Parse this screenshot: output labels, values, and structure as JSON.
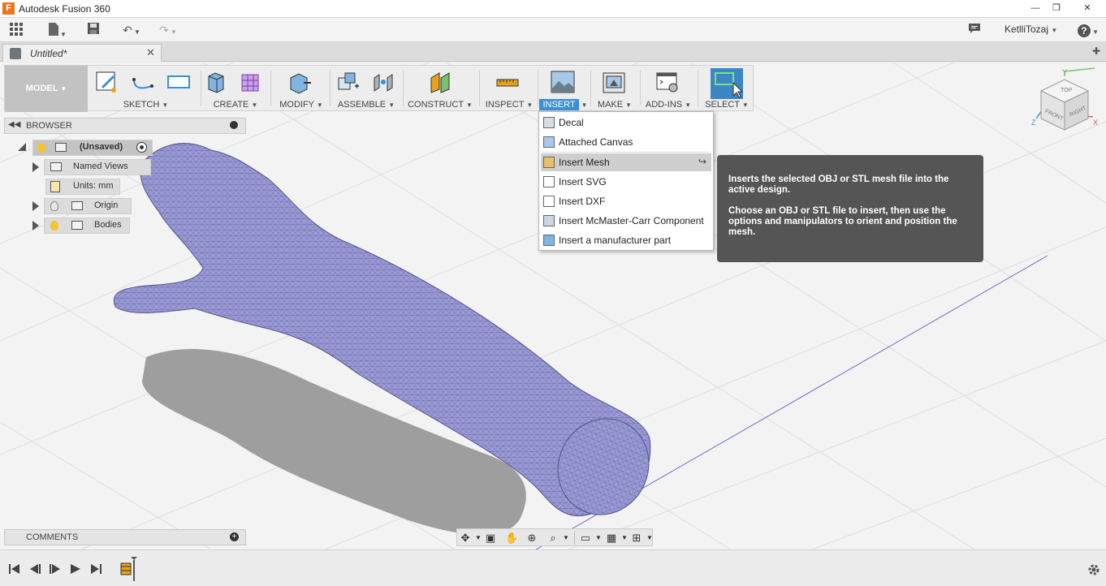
{
  "window": {
    "title": "Autodesk Fusion 360",
    "app_icon_letter": "F"
  },
  "quickaccess": {
    "user_name": "KetlliTozaj"
  },
  "document": {
    "tab_label": "Untitled*"
  },
  "ribbon": {
    "workspace": "MODEL",
    "groups": [
      {
        "label": "SKETCH"
      },
      {
        "label": "CREATE"
      },
      {
        "label": "MODIFY"
      },
      {
        "label": "ASSEMBLE"
      },
      {
        "label": "CONSTRUCT"
      },
      {
        "label": "INSPECT"
      },
      {
        "label": "INSERT"
      },
      {
        "label": "MAKE"
      },
      {
        "label": "ADD-INS"
      },
      {
        "label": "SELECT"
      }
    ]
  },
  "insert_menu": {
    "items": [
      {
        "label": "Decal",
        "icon": "decal-icon"
      },
      {
        "label": "Attached Canvas",
        "icon": "canvas-icon"
      },
      {
        "label": "Insert Mesh",
        "icon": "mesh-icon",
        "highlighted": true
      },
      {
        "label": "Insert SVG",
        "icon": "svg-icon"
      },
      {
        "label": "Insert DXF",
        "icon": "dxf-icon"
      },
      {
        "label": "Insert McMaster-Carr Component",
        "icon": "mcmaster-icon"
      },
      {
        "label": "Insert a manufacturer part",
        "icon": "manufacturer-part-icon"
      }
    ]
  },
  "tooltip": {
    "line1": "Inserts the selected OBJ or STL mesh file into the active design.",
    "line2": "Choose an OBJ or STL file to insert, then use the options and manipulators to orient and position the mesh."
  },
  "browser": {
    "header": "BROWSER",
    "root": "(Unsaved)",
    "items": [
      {
        "label": "Named Views"
      },
      {
        "label": "Units: mm"
      },
      {
        "label": "Origin"
      },
      {
        "label": "Bodies"
      }
    ]
  },
  "comments": {
    "header": "COMMENTS"
  },
  "viewcube": {
    "top": "TOP",
    "front": "FRONT",
    "right": "RIGHT",
    "axis_x": "X",
    "axis_y": "Y",
    "axis_z": "Z"
  },
  "colors": {
    "accent": "#3a8fd6",
    "mesh": "#9a9ad6",
    "tooltip_bg": "#555555"
  }
}
